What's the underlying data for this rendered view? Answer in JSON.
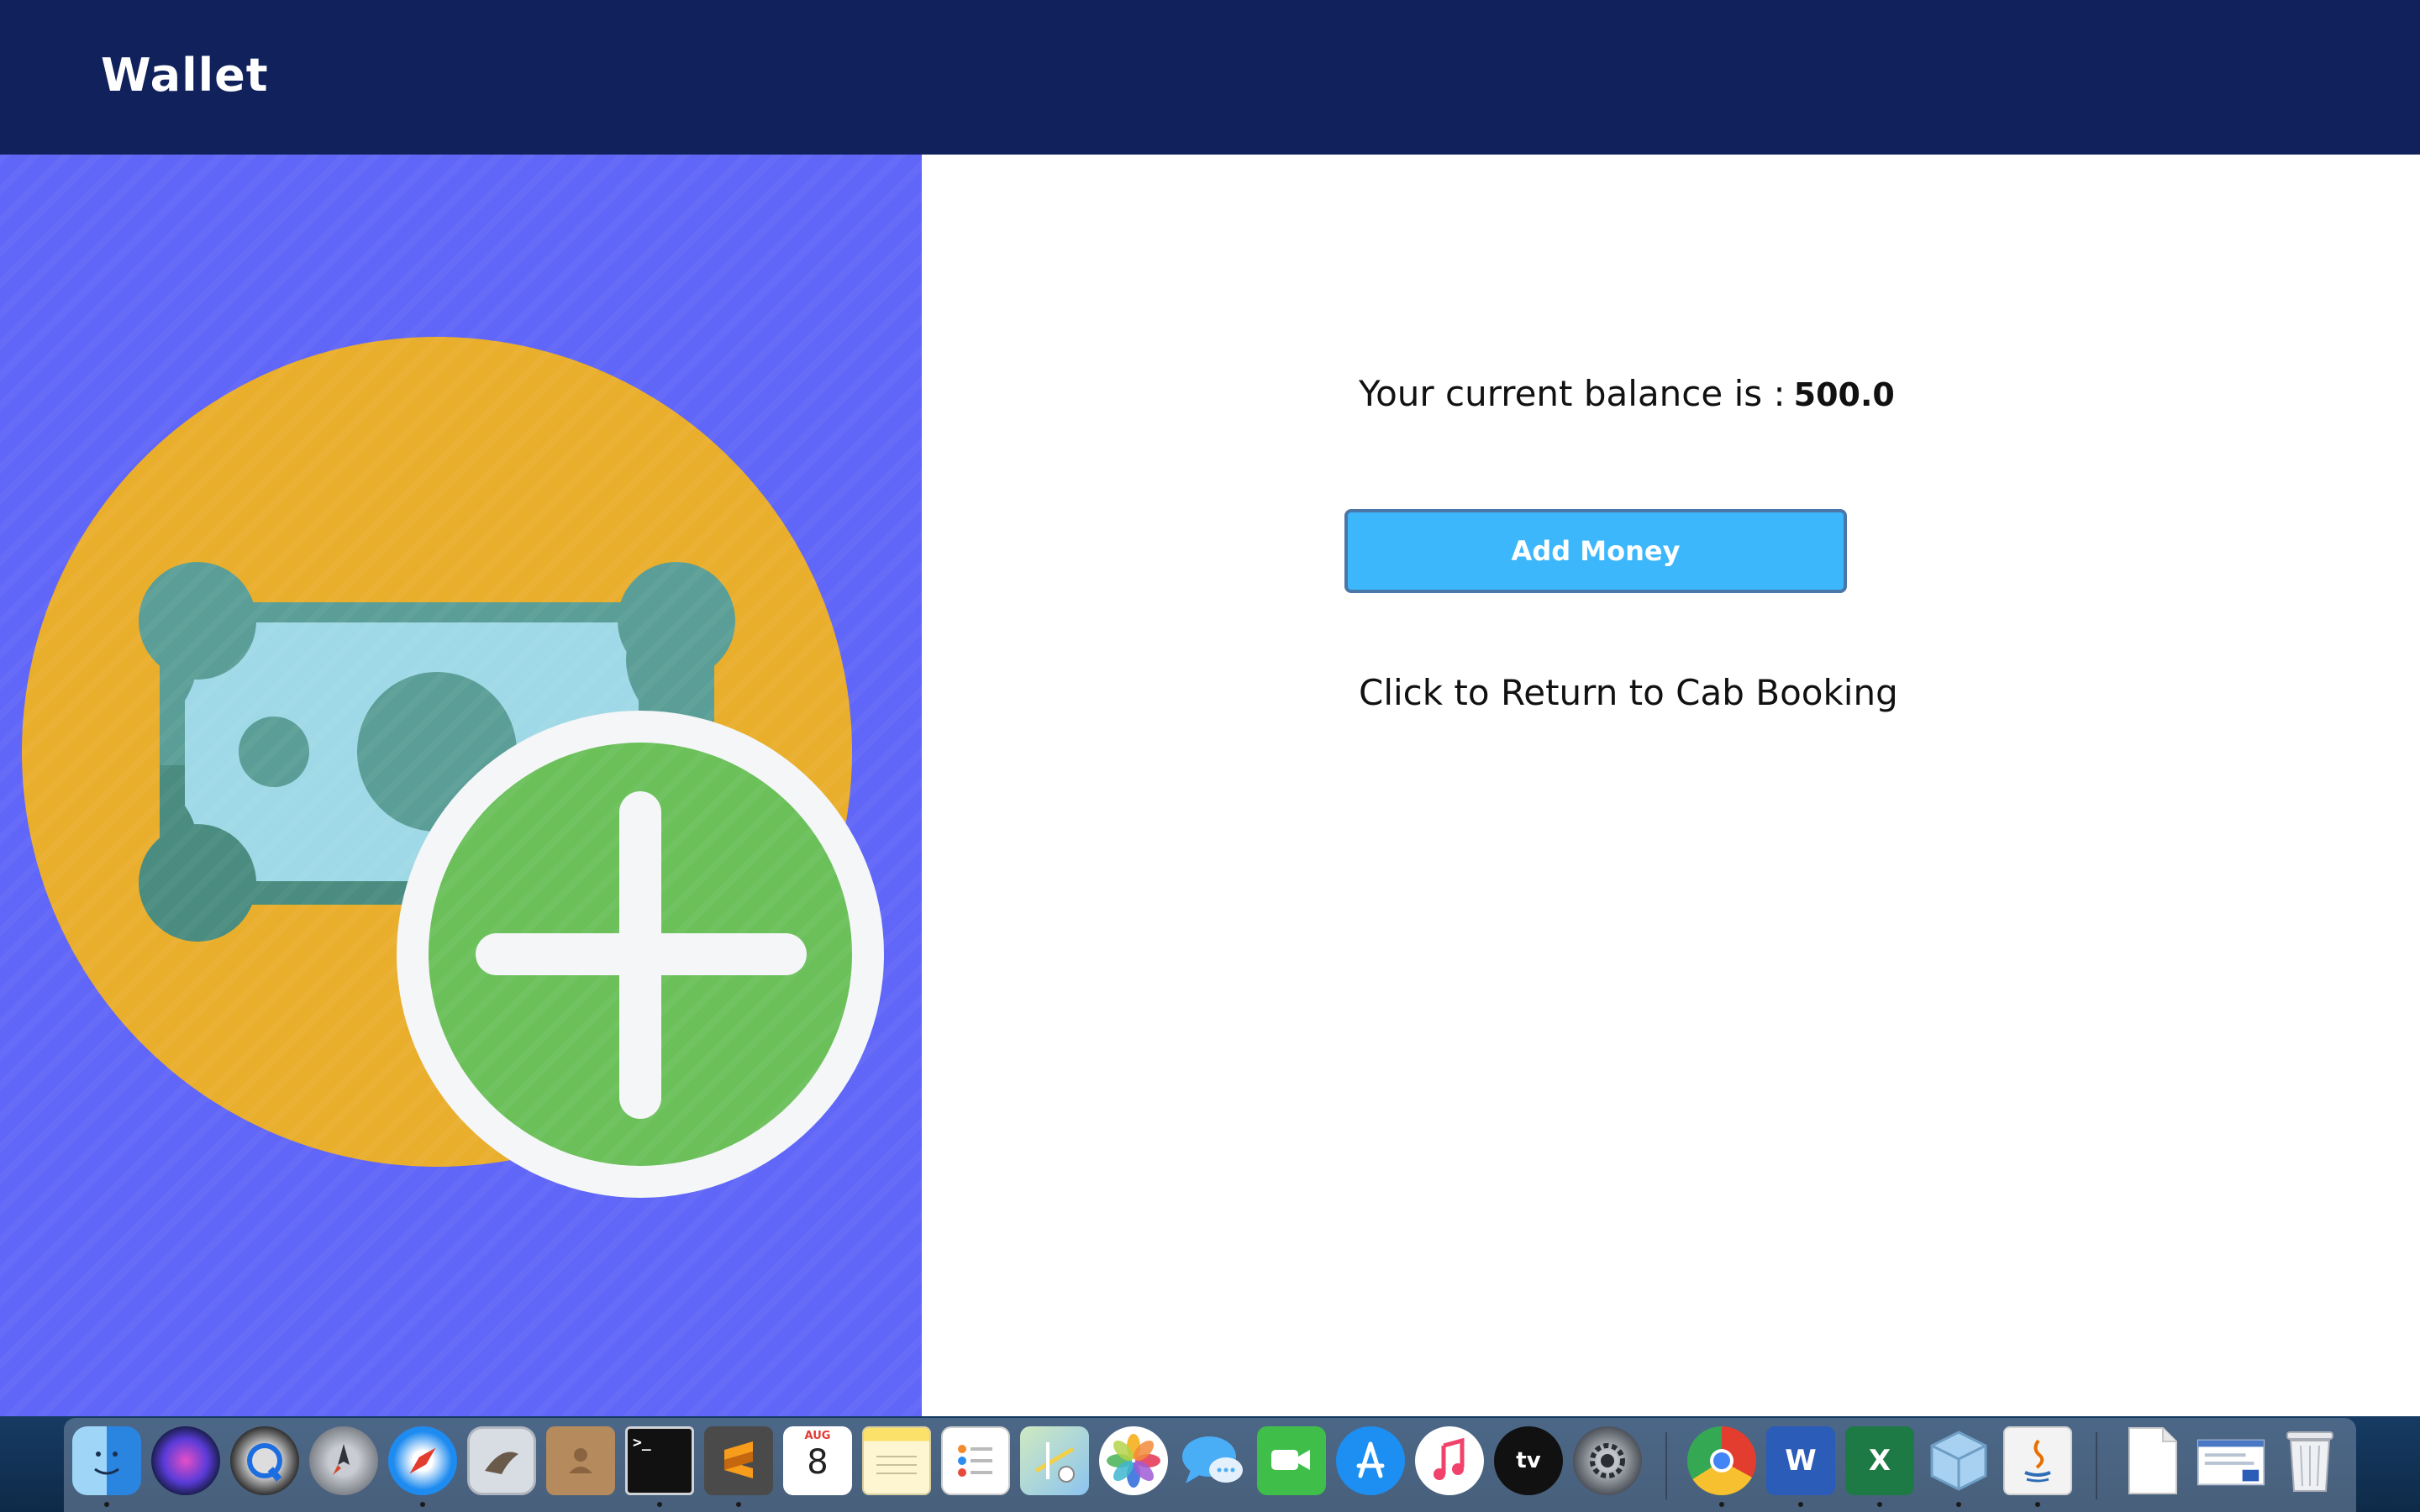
{
  "header": {
    "title": "Wallet"
  },
  "balance": {
    "label": "Your current balance is :",
    "value": "500.0"
  },
  "actions": {
    "add_money_label": "Add Money",
    "return_label": "Click to Return to Cab Booking"
  },
  "illustration": {
    "icon": "money-add-icon",
    "colors": {
      "background": "#6066f8",
      "circle": "#e9ae2c",
      "bill_dark": "#5a9e97",
      "bill_light": "#9fd8e6",
      "plus_circle": "#6bc05a"
    }
  },
  "colors": {
    "header_bg": "#10215c",
    "button_bg": "#3db7fb"
  },
  "dock": {
    "calendar_month": "AUG",
    "calendar_day": "8",
    "tv_label": "tv",
    "items": [
      {
        "name": "Finder",
        "icon": "finder-icon"
      },
      {
        "name": "Siri",
        "icon": "siri-icon"
      },
      {
        "name": "QuickTime Player",
        "icon": "quicktime-icon"
      },
      {
        "name": "Launchpad",
        "icon": "launchpad-icon"
      },
      {
        "name": "Safari",
        "icon": "safari-icon"
      },
      {
        "name": "Mail",
        "icon": "mail-icon"
      },
      {
        "name": "Contacts",
        "icon": "contacts-icon"
      },
      {
        "name": "Terminal",
        "icon": "terminal-icon"
      },
      {
        "name": "Sublime Text",
        "icon": "sublime-icon"
      },
      {
        "name": "Calendar",
        "icon": "calendar-icon"
      },
      {
        "name": "Notes",
        "icon": "notes-icon"
      },
      {
        "name": "Reminders",
        "icon": "reminders-icon"
      },
      {
        "name": "Maps",
        "icon": "maps-icon"
      },
      {
        "name": "Photos",
        "icon": "photos-icon"
      },
      {
        "name": "Messages",
        "icon": "messages-icon"
      },
      {
        "name": "FaceTime",
        "icon": "facetime-icon"
      },
      {
        "name": "App Store",
        "icon": "appstore-icon"
      },
      {
        "name": "Music",
        "icon": "music-icon"
      },
      {
        "name": "TV",
        "icon": "tv-icon"
      },
      {
        "name": "System Preferences",
        "icon": "system-preferences-icon"
      },
      {
        "name": "Google Chrome",
        "icon": "chrome-icon"
      },
      {
        "name": "Microsoft Word",
        "icon": "word-icon"
      },
      {
        "name": "Microsoft Excel",
        "icon": "excel-icon"
      },
      {
        "name": "VirtualBox",
        "icon": "virtualbox-icon"
      },
      {
        "name": "Java",
        "icon": "java-icon"
      },
      {
        "name": "Document",
        "icon": "document-icon"
      },
      {
        "name": "Word Document",
        "icon": "word-document-icon"
      },
      {
        "name": "Trash",
        "icon": "trash-icon"
      }
    ]
  }
}
